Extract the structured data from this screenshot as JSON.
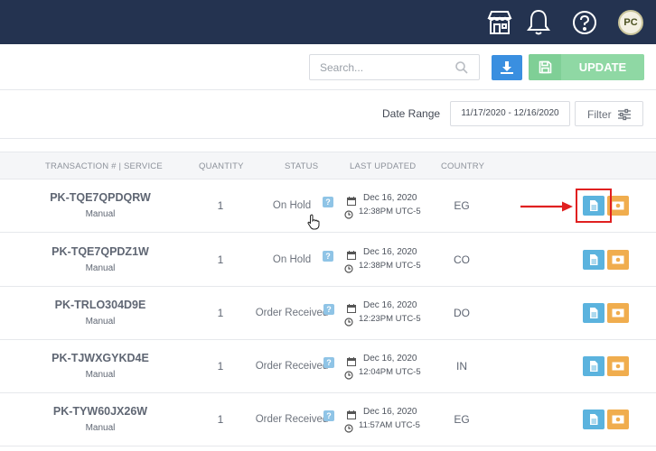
{
  "header": {
    "icons": [
      "store-icon",
      "bell-icon",
      "help-icon"
    ],
    "avatar_initials": "PC"
  },
  "toolbar": {
    "search_placeholder": "Search...",
    "update_label": "UPDATE"
  },
  "filters": {
    "date_range_label": "Date Range",
    "date_range_value": "11/17/2020 - 12/16/2020",
    "filter_label": "Filter"
  },
  "table": {
    "columns": {
      "transaction": "TRANSACTION # | SERVICE",
      "quantity": "QUANTITY",
      "status": "STATUS",
      "last_updated": "LAST UPDATED",
      "country": "COUNTRY"
    },
    "rows": [
      {
        "transaction": "PK-TQE7QPDQRW",
        "service": "Manual",
        "quantity": "1",
        "status": "On Hold",
        "date": "Dec 16, 2020",
        "time": "12:38PM UTC-5",
        "country": "EG"
      },
      {
        "transaction": "PK-TQE7QPDZ1W",
        "service": "Manual",
        "quantity": "1",
        "status": "On Hold",
        "date": "Dec 16, 2020",
        "time": "12:38PM UTC-5",
        "country": "CO"
      },
      {
        "transaction": "PK-TRLO304D9E",
        "service": "Manual",
        "quantity": "1",
        "status": "Order Received",
        "date": "Dec 16, 2020",
        "time": "12:23PM UTC-5",
        "country": "DO"
      },
      {
        "transaction": "PK-TJWXGYKD4E",
        "service": "Manual",
        "quantity": "1",
        "status": "Order Received",
        "date": "Dec 16, 2020",
        "time": "12:04PM UTC-5",
        "country": "IN"
      },
      {
        "transaction": "PK-TYW60JX26W",
        "service": "Manual",
        "quantity": "1",
        "status": "Order Received",
        "date": "Dec 16, 2020",
        "time": "11:57AM UTC-5",
        "country": "EG"
      }
    ],
    "status_help_glyph": "?"
  },
  "colors": {
    "topbar": "#243350",
    "download_button": "#3a8fe0",
    "update_button": "#8fd8a4",
    "document_button": "#5bb3de",
    "cash_button": "#f0ad4e",
    "annotation": "#e02020"
  }
}
